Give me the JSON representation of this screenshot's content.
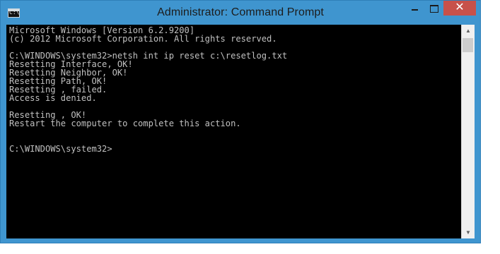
{
  "window": {
    "title": "Administrator: Command Prompt",
    "icon_text": "C:\\",
    "controls": {
      "minimize": "minimize-icon",
      "maximize": "maximize-icon",
      "close": "✕"
    }
  },
  "console": {
    "lines": [
      "Microsoft Windows [Version 6.2.9200]",
      "(c) 2012 Microsoft Corporation. All rights reserved.",
      "",
      "C:\\WINDOWS\\system32>netsh int ip reset c:\\resetlog.txt",
      "Resetting Interface, OK!",
      "Resetting Neighbor, OK!",
      "Resetting Path, OK!",
      "Resetting , failed.",
      "Access is denied.",
      "",
      "Resetting , OK!",
      "Restart the computer to complete this action.",
      "",
      "",
      "C:\\WINDOWS\\system32>"
    ]
  },
  "scrollbar": {
    "up": "▲",
    "down": "▼"
  }
}
